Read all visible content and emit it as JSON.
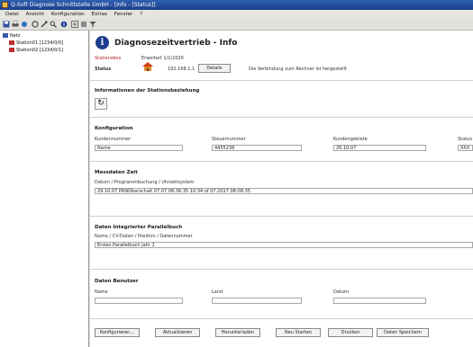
{
  "window": {
    "title": "Q-Soft Diagnose Schnittstelle GmbH - [Info - [Status]]"
  },
  "menu": [
    "Datei",
    "Ansicht",
    "Konfiguration",
    "Extras",
    "Fenster",
    "?"
  ],
  "toolbar_icons": [
    "save-icon",
    "print-icon",
    "connect-icon",
    "settings-icon",
    "tools-icon",
    "search-icon",
    "info-icon",
    "help-icon",
    "config-icon",
    "filter-icon"
  ],
  "tree": {
    "root": "Netz",
    "items": [
      "Station01 [1234/0/0]",
      "Station02 [1234/0/1]"
    ]
  },
  "header": {
    "title": "Diagnosezeitvertrieb - Info"
  },
  "station": {
    "type_label": "Stationsbox",
    "type_value": "Erweitert 1/1/2020",
    "status_label": "Status",
    "status_id": "192.168.1.1",
    "status_button": "Details",
    "status_text": "Die Verbindung zum Rechner ist hergestellt"
  },
  "section_status": {
    "title": "Informationen der Stationsbeziehung"
  },
  "section_config": {
    "title": "Konfiguration",
    "labels": [
      "Kundennummer",
      "Steuernummer",
      "Kundengebiete",
      "Status"
    ],
    "values": [
      "Name",
      "4455236",
      "26.10.07",
      "XXX"
    ]
  },
  "section_time": {
    "title": "Messdaten Zeit",
    "label": "Datum / Programmbuchung / Uhrzeitsystem",
    "value": "29.10.07   PRNOberschalt 07.07   08:36:35   10:34 of 07.2017   08:08:35"
  },
  "section_parallel": {
    "title": "Daten Integrierter Parallelbuch",
    "label": "Name / CV-Daten / Position / Datennummer",
    "value": "Erstes Parallelbuch Jahr 1"
  },
  "section_accounts": {
    "title": "Daten Benutzer",
    "labels": [
      "Name",
      "Land",
      "Datum"
    ],
    "values": [
      "",
      "",
      ""
    ]
  },
  "buttons": [
    "Konfigurieren...",
    "Aktualisieren",
    "Herunterladen",
    "Neu Starten",
    "Drucken",
    "Daten Speichern"
  ]
}
